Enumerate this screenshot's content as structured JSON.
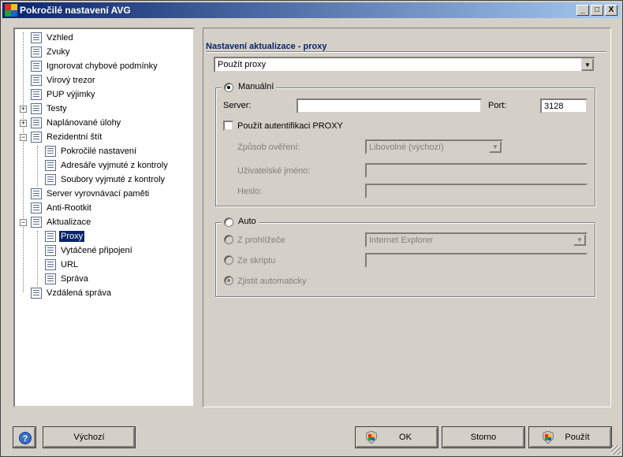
{
  "window": {
    "title": "Pokročilé nastavení AVG",
    "controls": {
      "minimize": "_",
      "maximize": "□",
      "close": "X"
    }
  },
  "tree": {
    "items": [
      {
        "label": "Vzhled"
      },
      {
        "label": "Zvuky"
      },
      {
        "label": "Ignorovat chybové podmínky"
      },
      {
        "label": "Virový trezor"
      },
      {
        "label": "PUP výjimky"
      },
      {
        "label": "Testy"
      },
      {
        "label": "Naplánované úlohy"
      },
      {
        "label": "Rezidentní štít"
      },
      {
        "label": "Pokročilé nastavení"
      },
      {
        "label": "Adresáře vyjmuté z kontroly"
      },
      {
        "label": "Soubory vyjmuté z kontroly"
      },
      {
        "label": "Server vyrovnávací paměti"
      },
      {
        "label": "Anti-Rootkit"
      },
      {
        "label": "Aktualizace"
      },
      {
        "label": "Proxy"
      },
      {
        "label": "Vytáčené připojení"
      },
      {
        "label": "URL"
      },
      {
        "label": "Správa"
      },
      {
        "label": "Vzdálená správa"
      }
    ],
    "expanders": {
      "plus": "+",
      "minus": "−"
    }
  },
  "proxy": {
    "section_title": "Nastavení aktualizace - proxy",
    "mode_select": "Použít proxy",
    "manual": {
      "label": "Manuální",
      "server_label": "Server:",
      "server_value": "",
      "port_label": "Port:",
      "port_value": "3128",
      "auth_label": "Použít autentifikaci PROXY",
      "auth_method_label": "Způsob ověření:",
      "auth_method_value": "Libovolné (výchozí)",
      "username_label": "Uživatelské jméno:",
      "username_value": "",
      "password_label": "Heslo:",
      "password_value": ""
    },
    "auto": {
      "label": "Auto",
      "browser_label": "Z prohlížeče",
      "browser_value": "Internet Explorer",
      "script_label": "Ze skriptu",
      "script_value": "",
      "detect_label": "Zjistit automaticky"
    }
  },
  "footer": {
    "help_glyph": "?",
    "default_label": "Výchozí",
    "ok_label": "OK",
    "cancel_label": "Storno",
    "apply_label": "Použít"
  },
  "colors": {
    "titlebar_start": "#0a246a",
    "titlebar_end": "#a6caf0",
    "section_title": "#0a246a",
    "selection": "#0a246a",
    "face": "#d4d0c8"
  }
}
